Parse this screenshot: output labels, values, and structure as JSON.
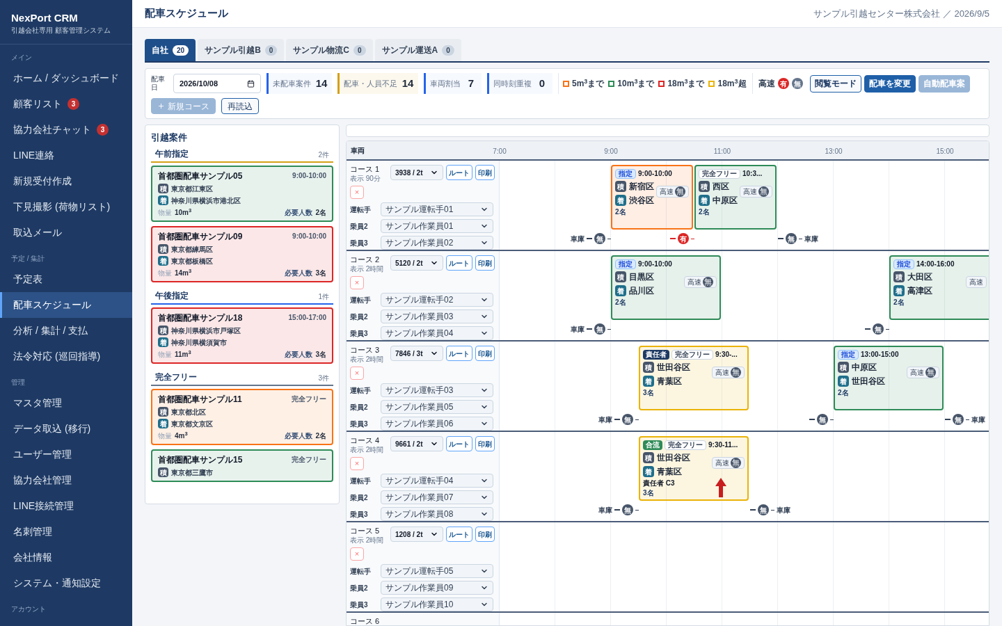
{
  "sidebar": {
    "brand": "NexPort CRM",
    "subtitle": "引越会社専用 顧客管理システム",
    "sections": [
      {
        "heading": "メイン",
        "items": [
          {
            "label": "ホーム / ダッシュボード",
            "selected": false
          },
          {
            "label": "顧客リスト",
            "badge": "3",
            "selected": false
          },
          {
            "label": "協力会社チャット",
            "badge": "3",
            "selected": false
          },
          {
            "label": "LINE連絡",
            "selected": false
          },
          {
            "label": "新規受付作成",
            "selected": false
          },
          {
            "label": "下見撮影 (荷物リスト)",
            "selected": false
          },
          {
            "label": "取込メール",
            "selected": false
          }
        ]
      },
      {
        "heading": "予定 / 集計",
        "items": [
          {
            "label": "予定表",
            "selected": false
          },
          {
            "label": "配車スケジュール",
            "selected": true
          },
          {
            "label": "分析 / 集計 / 支払",
            "selected": false
          },
          {
            "label": "法令対応 (巡回指導)",
            "selected": false
          }
        ]
      },
      {
        "heading": "管理",
        "items": [
          {
            "label": "マスタ管理",
            "selected": false
          },
          {
            "label": "データ取込 (移行)",
            "selected": false
          },
          {
            "label": "ユーザー管理",
            "selected": false
          },
          {
            "label": "協力会社管理",
            "selected": false
          },
          {
            "label": "LINE接続管理",
            "selected": false
          },
          {
            "label": "名刺管理",
            "selected": false
          },
          {
            "label": "会社情報",
            "selected": false
          },
          {
            "label": "システム・通知設定",
            "selected": false
          }
        ]
      },
      {
        "heading": "アカウント"
      }
    ]
  },
  "header": {
    "title": "配車スケジュール",
    "org": "サンプル引越センター株式会社 ／ 2026/9/5"
  },
  "tabs": [
    {
      "label": "自社",
      "count": "20",
      "selected": true
    },
    {
      "label": "サンプル引越B",
      "count": "0",
      "selected": false
    },
    {
      "label": "サンプル物流C",
      "count": "0",
      "selected": false
    },
    {
      "label": "サンプル運送A",
      "count": "0",
      "selected": false
    }
  ],
  "toolbar": {
    "date_label": "配車日",
    "date": "2026/10/08",
    "stats": [
      {
        "label": "未配車案件",
        "value": "14",
        "color": "#2563eb"
      },
      {
        "label": "配車・人員不足",
        "value": "14",
        "color": "#d4a017"
      },
      {
        "label": "車両割当",
        "value": "7",
        "color": "#2563eb"
      },
      {
        "label": "同時刻重複",
        "value": "0",
        "color": "#2563eb"
      }
    ],
    "legend": [
      {
        "label": "5m$^{3}$まで",
        "color": "#f97316"
      },
      {
        "label": "10m$^{3}$まで",
        "color": "#2e8b57"
      },
      {
        "label": "18m$^{3}$まで",
        "color": "#dc2626"
      },
      {
        "label": "18m$^{3}$超",
        "color": "#eab308"
      }
    ],
    "highway": {
      "label": "高速",
      "marks": [
        {
          "text": "有",
          "toll": true
        },
        {
          "text": "無",
          "toll": false
        }
      ]
    },
    "buttons": [
      {
        "label": "閲覧モード",
        "kind": "outline",
        "disabled": false
      },
      {
        "label": "配車を変更",
        "kind": "primary",
        "disabled": false
      },
      {
        "label": "自動配車案",
        "kind": "primary",
        "disabled": true
      }
    ],
    "actions": [
      {
        "label": "新規コース",
        "kind": "add",
        "disabled": true
      },
      {
        "label": "再読込",
        "kind": "outline",
        "disabled": false
      }
    ]
  },
  "jobs_panel": {
    "title": "引越案件",
    "groups": [
      {
        "title": "午前指定",
        "count": "2件",
        "color": "#d4a017",
        "cards": [
          {
            "name": "首都圏配車サンプル05",
            "time": "9:00-10:00",
            "from_tag": "積",
            "from": "東京都江東区",
            "to_tag": "着",
            "to": "神奈川県横浜市港北区",
            "volume_label": "物量",
            "volume": "10m$^{3}$",
            "crew_label": "必要人数",
            "crew": "2名",
            "color": "#2e8b57"
          },
          {
            "name": "首都圏配車サンプル09",
            "time": "9:00-10:00",
            "from_tag": "積",
            "from": "東京都練馬区",
            "to_tag": "着",
            "to": "東京都板橋区",
            "volume_label": "物量",
            "volume": "14m$^{3}$",
            "crew_label": "必要人数",
            "crew": "3名",
            "color": "#dc2626"
          }
        ]
      },
      {
        "title": "午後指定",
        "count": "1件",
        "color": "#2563eb",
        "cards": [
          {
            "name": "首都圏配車サンプル18",
            "time": "15:00-17:00",
            "from_tag": "積",
            "from": "神奈川県横浜市戸塚区",
            "to_tag": "着",
            "to": "神奈川県横須賀市",
            "volume_label": "物量",
            "volume": "11m$^{3}$",
            "crew_label": "必要人数",
            "crew": "3名",
            "color": "#dc2626"
          }
        ]
      },
      {
        "title": "完全フリー",
        "count": "3件",
        "color": "#64748b",
        "cards": [
          {
            "name": "首都圏配車サンプル11",
            "time": "完全フリー",
            "from_tag": "積",
            "from": "東京都北区",
            "to_tag": "着",
            "to": "東京都文京区",
            "volume_label": "物量",
            "volume": "4m$^{3}$",
            "crew_label": "必要人数",
            "crew": "2名",
            "color": "#f97316"
          },
          {
            "name": "首都圏配車サンプル15",
            "time": "完全フリー",
            "from_tag": "積",
            "from": "東京都三鷹市",
            "color": "#2e8b57"
          }
        ]
      }
    ]
  },
  "schedule": {
    "vehicle_header": "車両",
    "hours": [
      "7:00",
      "9:00",
      "11:00",
      "13:00",
      "15:00"
    ],
    "courses": [
      {
        "name": "コース 1",
        "display": "表示 90分",
        "vehicle": "3938 / 2t",
        "route": "ルート",
        "print": "印刷",
        "remove": "×",
        "staff": [
          {
            "role": "運転手",
            "name": "サンプル運転手01"
          },
          {
            "role": "乗員2",
            "name": "サンプル作業員01"
          },
          {
            "role": "乗員3",
            "name": "サンプル作業員02"
          }
        ],
        "jobs": [
          {
            "tags": [
              {
                "kind": "designated",
                "text": "指定"
              }
            ],
            "time": "9:00-10:00",
            "from_tag": "積",
            "from": "新宿区",
            "to_tag": "着",
            "to": "渋谷区",
            "highway": "高速",
            "highway_mark": "無",
            "crew": "2名",
            "color": "#f97316",
            "alert": false,
            "lead": {
              "depot": "車庫",
              "mark": "無",
              "toll": false
            }
          },
          {
            "tags": [
              {
                "kind": "free",
                "text": "完全フリー"
              }
            ],
            "time": "10:3...",
            "from_tag": "積",
            "from": "西区",
            "to_tag": "着",
            "to": "中原区",
            "highway": "高速",
            "highway_mark": "無",
            "crew": "2名",
            "color": "#2e8b57",
            "alert": false,
            "lead": {
              "mark": "有",
              "toll": true
            }
          }
        ],
        "tail": {
          "mark": "無",
          "toll": false,
          "depot": "車庫"
        }
      },
      {
        "name": "コース 2",
        "display": "表示 2時間",
        "vehicle": "5120 / 2t",
        "route": "ルート",
        "print": "印刷",
        "remove": "×",
        "staff": [
          {
            "role": "運転手",
            "name": "サンプル運転手02"
          },
          {
            "role": "乗員2",
            "name": "サンプル作業員03"
          },
          {
            "role": "乗員3",
            "name": "サンプル作業員04"
          }
        ],
        "jobs": [
          {
            "tags": [
              {
                "kind": "designated",
                "text": "指定"
              }
            ],
            "time": "9:00-10:00",
            "from_tag": "積",
            "from": "目黒区",
            "to_tag": "着",
            "to": "品川区",
            "highway": "高速",
            "highway_mark": "無",
            "crew": "2名",
            "color": "#2e8b57",
            "alert": false,
            "lead": {
              "depot": "車庫",
              "mark": "無",
              "toll": false
            }
          },
          {
            "tags": [
              {
                "kind": "designated",
                "text": "指定"
              }
            ],
            "time": "14:00-16:00",
            "from_tag": "積",
            "from": "大田区",
            "to_tag": "着",
            "to": "高津区",
            "highway": "高速",
            "crew": "2名",
            "color": "#2e8b57",
            "alert": false,
            "lead": {
              "mark": "無",
              "toll": false
            }
          }
        ]
      },
      {
        "name": "コース 3",
        "display": "表示 2時間",
        "vehicle": "7846 / 3t",
        "route": "ルート",
        "print": "印刷",
        "remove": "×",
        "staff": [
          {
            "role": "運転手",
            "name": "サンプル運転手03"
          },
          {
            "role": "乗員2",
            "name": "サンプル作業員05"
          },
          {
            "role": "乗員3",
            "name": "サンプル作業員06"
          }
        ],
        "jobs": [
          {
            "tags": [
              {
                "kind": "leader",
                "text": "責任者"
              },
              {
                "kind": "free",
                "text": "完全フリー"
              }
            ],
            "time": "9:30-...",
            "from_tag": "積",
            "from": "世田谷区",
            "to_tag": "着",
            "to": "青葉区",
            "highway": "高速",
            "highway_mark": "無",
            "crew": "3名",
            "color": "#eab308",
            "alert": false,
            "lead": {
              "depot": "車庫",
              "mark": "無",
              "toll": false
            }
          },
          {
            "tags": [
              {
                "kind": "designated",
                "text": "指定"
              }
            ],
            "time": "13:00-15:00",
            "from_tag": "積",
            "from": "中原区",
            "to_tag": "着",
            "to": "世田谷区",
            "highway": "高速",
            "highway_mark": "無",
            "crew": "2名",
            "color": "#2e8b57",
            "alert": false,
            "lead": {
              "mark": "無",
              "toll": false
            }
          }
        ],
        "tail": {
          "mark": "無",
          "toll": false,
          "depot": "車庫"
        }
      },
      {
        "name": "コース 4",
        "display": "表示 2時間",
        "vehicle": "9661 / 2t",
        "route": "ルート",
        "print": "印刷",
        "remove": "×",
        "staff": [
          {
            "role": "運転手",
            "name": "サンプル運転手04"
          },
          {
            "role": "乗員2",
            "name": "サンプル作業員07"
          },
          {
            "role": "乗員3",
            "name": "サンプル作業員08"
          }
        ],
        "jobs": [
          {
            "tags": [
              {
                "kind": "merge",
                "text": "合流"
              },
              {
                "kind": "free",
                "text": "完全フリー"
              }
            ],
            "time": "9:30-11...",
            "from_tag": "積",
            "from": "世田谷区",
            "to_tag": "着",
            "to": "青葉区",
            "highway": "高速",
            "highway_mark": "無",
            "leader": "責任者 C3",
            "crew": "3名",
            "color": "#eab308",
            "alert": true,
            "lead": {
              "depot": "車庫",
              "mark": "無",
              "toll": false
            }
          }
        ],
        "tail": {
          "mark": "無",
          "toll": false,
          "depot": "車庫"
        }
      },
      {
        "name": "コース 5",
        "display": "表示 2時間",
        "vehicle": "1208 / 2t",
        "route": "ルート",
        "print": "印刷",
        "remove": "×",
        "staff": [
          {
            "role": "運転手",
            "name": "サンプル運転手05"
          },
          {
            "role": "乗員2",
            "name": "サンプル作業員09"
          },
          {
            "role": "乗員3",
            "name": "サンプル作業員10"
          }
        ]
      },
      {
        "name": "コース 6"
      }
    ]
  }
}
